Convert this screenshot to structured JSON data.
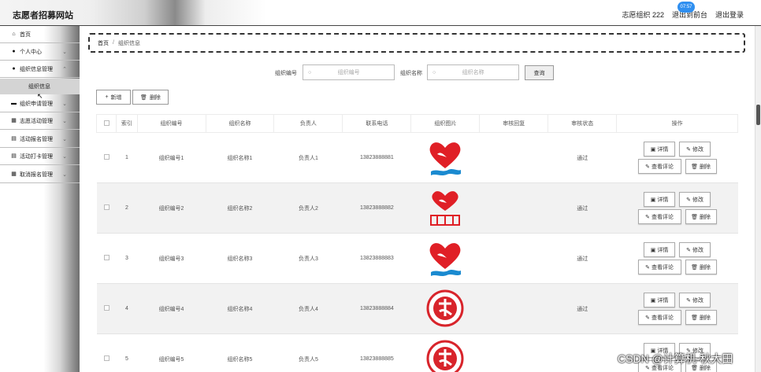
{
  "header": {
    "site_title": "志愿者招募网站",
    "user": "志愿组织 222",
    "front_link": "退出到前台",
    "logout": "退出登录",
    "time_badge": "07:57"
  },
  "sidebar": {
    "items": [
      {
        "label": "首页",
        "icon": "home-icon"
      },
      {
        "label": "个人中心",
        "icon": "user-icon"
      },
      {
        "label": "组织信息管理",
        "icon": "user-icon"
      },
      {
        "label": "组织申请管理",
        "icon": "card-icon"
      },
      {
        "label": "志愿活动管理",
        "icon": "grid-icon"
      },
      {
        "label": "活动报名管理",
        "icon": "table-icon"
      },
      {
        "label": "活动打卡管理",
        "icon": "table-icon"
      },
      {
        "label": "取消报名管理",
        "icon": "grid-icon"
      }
    ],
    "sub_item": "组织信息"
  },
  "breadcrumb": {
    "home": "首页",
    "sep": "/",
    "current": "组织信息"
  },
  "search": {
    "code_label": "组织编号",
    "code_placeholder": "组织编号",
    "name_label": "组织名称",
    "name_placeholder": "组织名称",
    "query_button": "查询"
  },
  "toolbar": {
    "add_label": "新增",
    "delete_label": "删除"
  },
  "table": {
    "headers": [
      "索引",
      "组织编号",
      "组织名称",
      "负责人",
      "联系电话",
      "组织图片",
      "审核回复",
      "审核状态",
      "操作"
    ],
    "rows": [
      {
        "index": "1",
        "code": "组织编号1",
        "name": "组织名称1",
        "leader": "负责人1",
        "phone": "13823888881",
        "reply": "",
        "status": "通过",
        "logo": "heart-hand-logo"
      },
      {
        "index": "2",
        "code": "组织编号2",
        "name": "组织名称2",
        "leader": "负责人2",
        "phone": "13823888882",
        "reply": "",
        "status": "通过",
        "logo": "heart-hand-text-logo"
      },
      {
        "index": "3",
        "code": "组织编号3",
        "name": "组织名称3",
        "leader": "负责人3",
        "phone": "13823888883",
        "reply": "",
        "status": "通过",
        "logo": "heart-hand-logo"
      },
      {
        "index": "4",
        "code": "组织编号4",
        "name": "组织名称4",
        "leader": "负责人4",
        "phone": "13823888884",
        "reply": "",
        "status": "通过",
        "logo": "round-seal-logo"
      },
      {
        "index": "5",
        "code": "组织编号5",
        "name": "组织名称5",
        "leader": "负责人5",
        "phone": "13823888885",
        "reply": "",
        "status": "",
        "logo": "round-seal-logo"
      }
    ],
    "ops": {
      "detail": "详情",
      "edit": "修改",
      "review": "查看评论",
      "delete": "删除"
    }
  },
  "watermark": "CSDN @计算机-秋大田"
}
